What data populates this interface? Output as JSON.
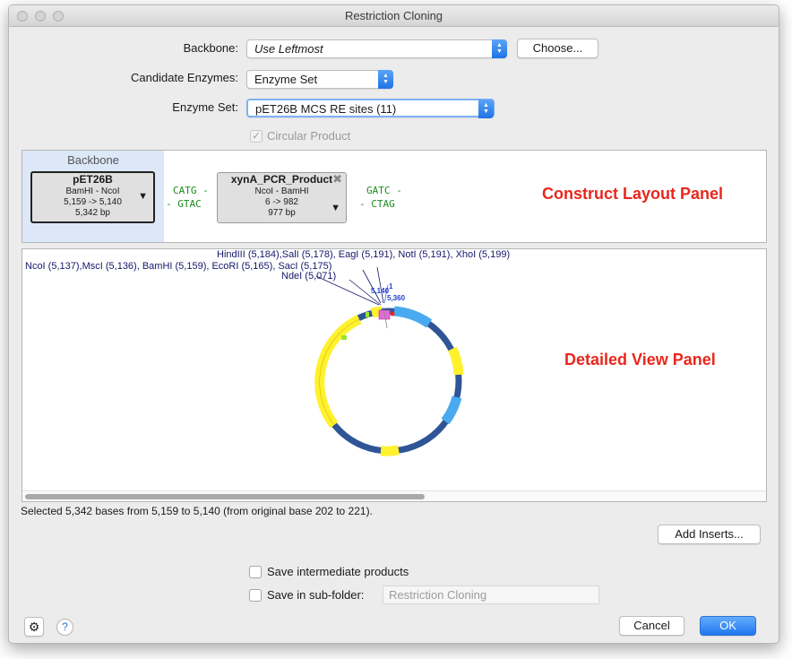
{
  "window": {
    "title": "Restriction Cloning"
  },
  "form": {
    "backbone_label": "Backbone:",
    "backbone_value": "Use Leftmost",
    "choose_button": "Choose...",
    "candidate_label": "Candidate Enzymes:",
    "candidate_value": "Enzyme Set",
    "enzymeset_label": "Enzyme Set:",
    "enzymeset_value": "pET26B MCS RE sites (11)",
    "circular_label": "Circular Product"
  },
  "layout": {
    "backbone_header": "Backbone",
    "backbone_fragment": {
      "name": "pET26B",
      "enzymes": "BamHI - NcoI",
      "range": "5,159 -> 5,140",
      "size": "5,342 bp"
    },
    "left_overhang_top": "CATG",
    "left_overhang_bottom": "GTAC",
    "insert_fragment": {
      "name": "xynA_PCR_Product",
      "enzymes": "NcoI - BamHI",
      "range": "6 -> 982",
      "size": "977 bp"
    },
    "right_overhang_top": "GATC",
    "right_overhang_bottom": "CTAG",
    "dash": "-",
    "annotation": "Construct Layout Panel"
  },
  "detail": {
    "sites_line1": "HindIII (5,184),SalI (5,178), EagI (5,191), NotI (5,191), XhoI (5,199)",
    "sites_line2": "NcoI (5,137),MscI (5,136), BamHI (5,159), EcoRI (5,165), SacI (5,175)",
    "sites_line3": "NdeI (5,071)",
    "tick_labels": [
      "5,140",
      "1",
      "5,360"
    ],
    "annotation": "Detailed View Panel"
  },
  "status_text": "Selected 5,342 bases from 5,159 to 5,140 (from original base 202 to 221).",
  "add_inserts_button": "Add Inserts...",
  "save_intermediate_label": "Save intermediate products",
  "save_subfolder_label": "Save in sub-folder:",
  "subfolder_placeholder": "Restriction Cloning",
  "cancel_button": "Cancel",
  "ok_button": "OK",
  "help_label": "?",
  "icons": {
    "gear": "gear-icon",
    "help": "help-icon",
    "close": "close-icon",
    "dropdown": "dropdown-icon"
  },
  "colors": {
    "accent": "#1f76f1",
    "annotation": "#e8271d",
    "backbone_ring": "#2f5597",
    "feature_yellow": "#fff12e",
    "feature_blue": "#4aaaf0"
  }
}
